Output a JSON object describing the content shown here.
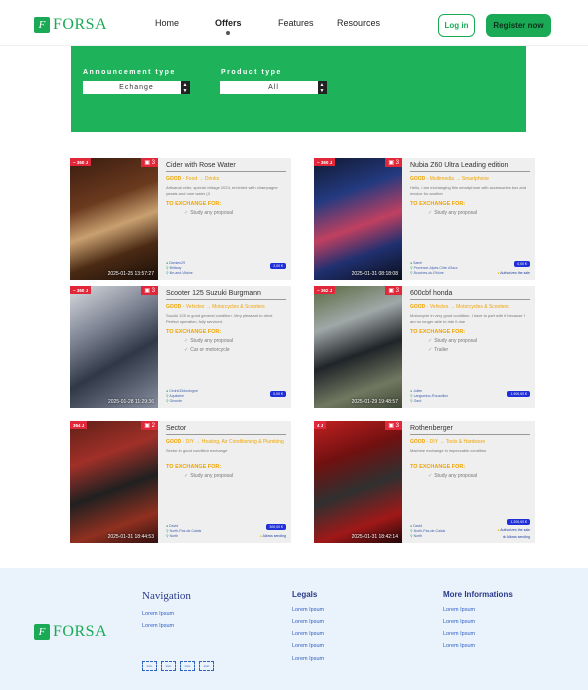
{
  "brand": {
    "name": "FORSA",
    "mark": "F"
  },
  "nav": {
    "items": [
      "Home",
      "Offers",
      "Features",
      "Resources"
    ],
    "active": "Offers"
  },
  "auth": {
    "login": "Log in",
    "register": "Register now"
  },
  "filters": {
    "announcement_label": "Announcement type",
    "announcement_value": "Echange",
    "product_label": "Product type",
    "product_value": "All",
    "accent": "#1eb25a"
  },
  "cards": [
    {
      "badge": "~ 360 J",
      "photos": "3",
      "date": "2025-01-25 13:57:27",
      "title": "Cider with Rose Water",
      "condition": "GOOD",
      "category": "Food",
      "subcategory": "Drinks",
      "desc": "Artisanal cider, special vintage 2024, enriched with champagne yeasts and rose water (3",
      "exchange_label": "TO EXCHANGE FOR:",
      "options": [
        "Study any proposal"
      ],
      "location": [
        "Damien29",
        "Brittany",
        "Ille-and-Vilaine"
      ],
      "price": "2,00 €",
      "extra": ""
    },
    {
      "badge": "~ 360 J",
      "photos": "3",
      "date": "2025-01-31 08:18:08",
      "title": "Nubia Z60 Ultra Leading edition",
      "condition": "GOOD",
      "category": "Multimedia",
      "subcategory": "Smartphone",
      "desc": "Hello, I am exchanging this smartphone with accessories box and invoice for another",
      "exchange_label": "TO EXCHANGE FOR:",
      "options": [
        "Study any proposal"
      ],
      "location": [
        "Samir",
        "Provence-Alpes-Côte d'Azur",
        "Bouches-du-Rhône"
      ],
      "price": "0,00 €",
      "extra": "Authorizes the sale"
    },
    {
      "badge": "~ 360 J",
      "photos": "3",
      "date": "2025-01-28 11:29:36",
      "title": "Scooter 125 Suzuki Burgmann",
      "condition": "GOOD",
      "category": "Vehicles",
      "subcategory": "Motorcycles & Scooters",
      "desc": "Suzuki 125 in good general condition. Very pleasant to drive. Perfect operation, fully serviced.",
      "exchange_label": "TO EXCHANGE FOR:",
      "options": [
        "Study any proposal",
        "Car or motorcycle"
      ],
      "location": [
        "Cedric33dordogne",
        "Aquitaine",
        "Gironde"
      ],
      "price": "0,00 €",
      "extra": ""
    },
    {
      "badge": "~ 362 J",
      "photos": "3",
      "date": "2025-01-29 19:48:57",
      "title": "600cbf honda",
      "condition": "GOOD",
      "category": "Vehicles",
      "subcategory": "Motorcycles & Scooters",
      "desc": "Motorcycle in very good condition. I have to part with it because I am no longer able to ride it due",
      "exchange_label": "TO EXCHANGE FOR:",
      "options": [
        "Study any proposal",
        "Trailer"
      ],
      "location": [
        "Julien",
        "Languedoc-Roussillon",
        "Gard"
      ],
      "price": "1.900,00 €",
      "extra": ""
    },
    {
      "badge": "364 J",
      "photos": "2",
      "date": "2025-01-31 18:44:53",
      "title": "Sector",
      "condition": "GOOD",
      "category": "DIY",
      "subcategory": "Heating, Air Conditioning & Plumbing",
      "desc": "Sector in good condition exchange",
      "exchange_label": "TO EXCHANGE FOR:",
      "options": [
        "Study any proposal"
      ],
      "location": [
        "David",
        "North-Pas-de-Calais",
        "North"
      ],
      "price": "300,00 €",
      "extra": "Allows sending"
    },
    {
      "badge": "4 J",
      "photos": "3",
      "date": "2025-01-31 18:42:14",
      "title": "Rothenberger",
      "condition": "GOOD",
      "category": "DIY",
      "subcategory": "Tools & Hardware",
      "desc": "Machine exchange in impeccable condition",
      "exchange_label": "TO EXCHANGE FOR:",
      "options": [
        "Study any proposal"
      ],
      "location": [
        "David",
        "North-Pas-de-Calais",
        "North"
      ],
      "price": "1.200,00 €",
      "extra": "Authorizes the sale",
      "extra2": "Allows sending"
    }
  ],
  "footer": {
    "nav_title": "Navigation",
    "nav_links": [
      "Lorem Ipsum",
      "Lorem Ipsum"
    ],
    "legal_title": "Legals",
    "legal_links": [
      "Lorem Ipsum",
      "Lorem Ipsum",
      "Lorem Ipsum",
      "Lorem Ipsum",
      "Lorem Ipsum"
    ],
    "more_title": "More Informations",
    "more_links": [
      "Lorem Ipsum",
      "Lorem Ipsum",
      "Lorem Ipsum",
      "Lorem Ipsum"
    ],
    "stores": [
      "Icon",
      "Icon",
      "Icon",
      "Icon"
    ]
  },
  "colors": {
    "brand_green": "#1aaa55",
    "badge_red": "#e0283a",
    "price_blue": "#2030d8",
    "category_orange": "#f0a500"
  }
}
